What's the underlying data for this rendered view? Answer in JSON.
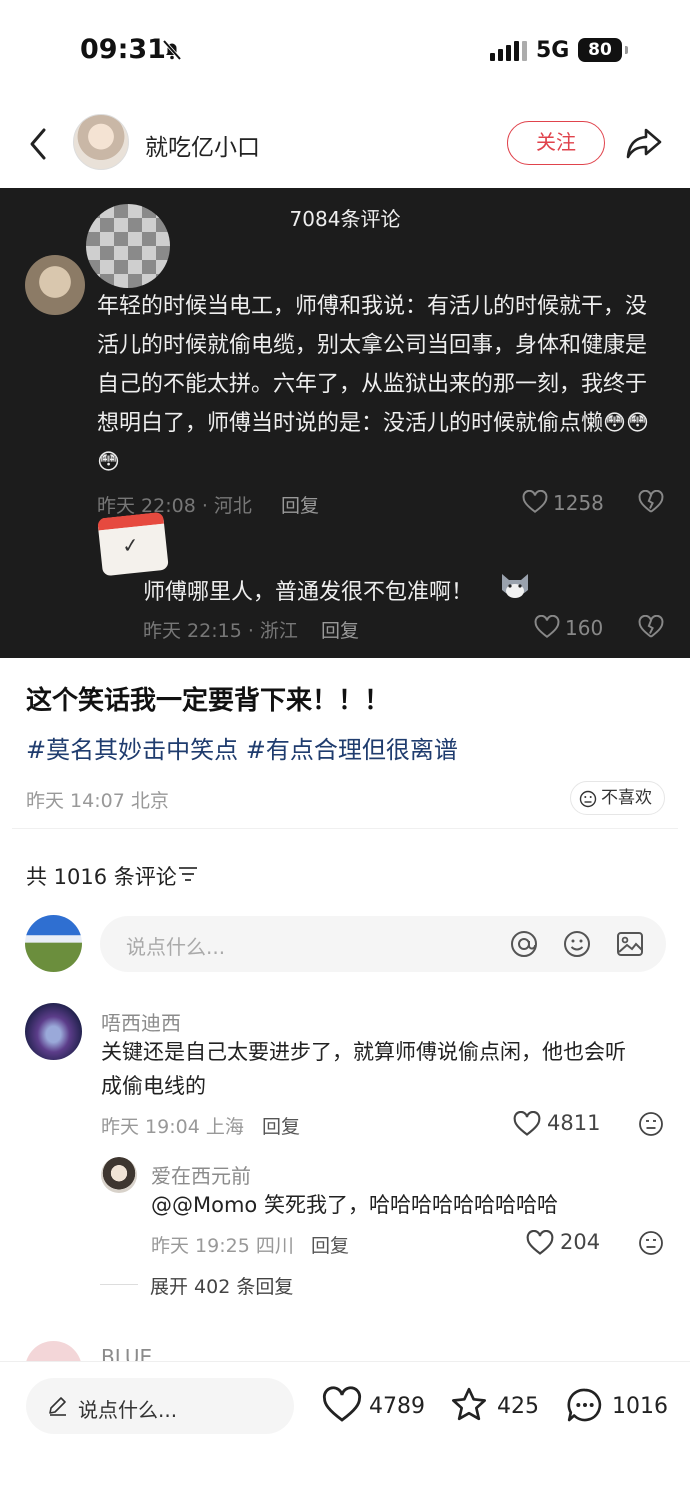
{
  "status_bar": {
    "time": "09:31",
    "network": "5G",
    "battery": "80"
  },
  "header": {
    "author": "就吃亿小口",
    "follow_label": "关注"
  },
  "image": {
    "comments_header": "7084条评论",
    "main_comment": {
      "text": "年轻的时候当电工，师傅和我说：有活儿的时候就干，没活儿的时候就偷电缆，别太拿公司当回事，身体和健康是自己的不能太拼。六年了，从监狱出来的那一刻，我终于想明白了，师傅当时说的是：没活儿的时候就偷点懒",
      "emojis": "😳😳😳",
      "meta": "昨天 22:08 · 河北",
      "reply_label": "回复",
      "likes": "1258"
    },
    "reply": {
      "text": "师傅哪里人，普通发很不包准啊！",
      "meta": "昨天 22:15 · 浙江",
      "reply_label": "回复",
      "likes": "160"
    }
  },
  "post": {
    "title": "这个笑话我一定要背下来！！！",
    "tags": "#莫名其妙击中笑点 #有点合理但很离谱",
    "meta": "昨天 14:07 北京",
    "dislike_label": "不喜欢"
  },
  "comments_section": {
    "count_label": "共 1016 条评论",
    "input_placeholder": "说点什么...",
    "comments": [
      {
        "name": "唔西迪西",
        "text_line1": "关键还是自己太要进步了，就算师傅说偷点闲，他也会听",
        "text_line2": "成偷电线的",
        "meta": "昨天 19:04 上海",
        "reply_label": "回复",
        "likes": "4811"
      },
      {
        "name": "爱在西元前",
        "text": "@@Momo 笑死我了，哈哈哈哈哈哈哈哈哈",
        "meta": "昨天 19:25 四川",
        "reply_label": "回复",
        "likes": "204"
      }
    ],
    "expand_label": "展开 402 条回复",
    "partial_name": "BLUE"
  },
  "bottom_bar": {
    "placeholder": "说点什么...",
    "likes": "4789",
    "stars": "425",
    "comments": "1016"
  },
  "colors": {
    "accent": "#e0434c",
    "tag": "#1f3c6e",
    "image_bg": "#1c1c1c"
  }
}
